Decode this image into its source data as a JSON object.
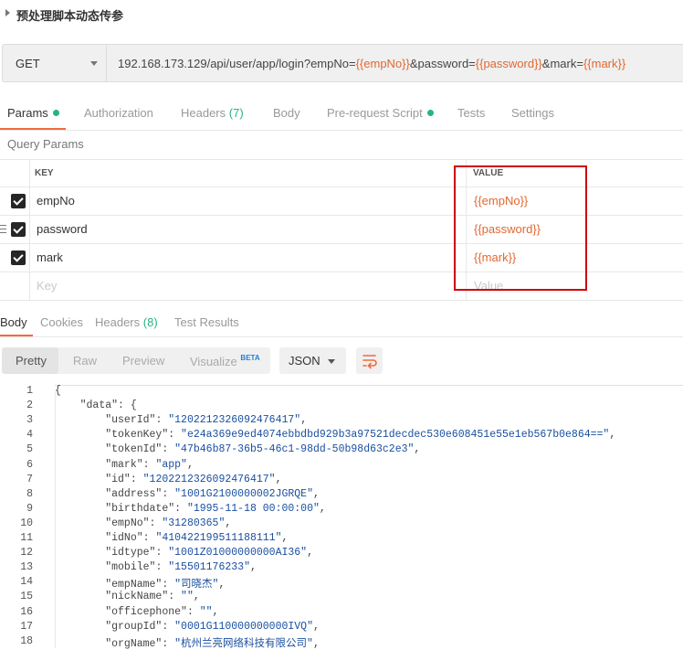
{
  "request": {
    "title": "预处理脚本动态传参",
    "method": "GET",
    "url_parts": [
      "192.168.173.129/api/user/app/login?empNo=",
      "{{empNo}}",
      "&password=",
      "{{password}}",
      "&mark=",
      "{{mark}}"
    ]
  },
  "tabs": {
    "params": "Params",
    "authorization": "Authorization",
    "headers": "Headers",
    "headers_count": "(7)",
    "body": "Body",
    "prerequest": "Pre-request Script",
    "tests": "Tests",
    "settings": "Settings"
  },
  "query": {
    "section_label": "Query Params",
    "col_key": "KEY",
    "col_value": "VALUE",
    "rows": [
      {
        "key": "empNo",
        "value": "{{empNo}}"
      },
      {
        "key": "password",
        "value": "{{password}}"
      },
      {
        "key": "mark",
        "value": "{{mark}}"
      }
    ],
    "key_placeholder": "Key",
    "value_placeholder": "Value"
  },
  "response": {
    "tabs": {
      "body": "Body",
      "cookies": "Cookies",
      "headers": "Headers",
      "headers_count": "(8)",
      "test_results": "Test Results"
    },
    "view": {
      "pretty": "Pretty",
      "raw": "Raw",
      "preview": "Preview",
      "visualize": "Visualize",
      "beta": "BETA",
      "format": "JSON"
    },
    "line_numbers": [
      "1",
      "2",
      "3",
      "4",
      "5",
      "6",
      "7",
      "8",
      "9",
      "10",
      "11",
      "12",
      "13",
      "14",
      "15",
      "16",
      "17",
      "18"
    ],
    "code": [
      {
        "indent": "",
        "key": "",
        "value": "",
        "text": "{"
      },
      {
        "indent": "    ",
        "key": "\"data\"",
        "sep": ": ",
        "value": "",
        "text": "{"
      },
      {
        "indent": "        ",
        "key": "\"userId\"",
        "sep": ": ",
        "value": "\"1202212326092476417\"",
        "text": ","
      },
      {
        "indent": "        ",
        "key": "\"tokenKey\"",
        "sep": ": ",
        "value": "\"e24a369e9ed4074ebbdbd929b3a97521decdec530e608451e55e1eb567b0e864==\"",
        "text": ","
      },
      {
        "indent": "        ",
        "key": "\"tokenId\"",
        "sep": ": ",
        "value": "\"47b46b87-36b5-46c1-98dd-50b98d63c2e3\"",
        "text": ","
      },
      {
        "indent": "        ",
        "key": "\"mark\"",
        "sep": ": ",
        "value": "\"app\"",
        "text": ","
      },
      {
        "indent": "        ",
        "key": "\"id\"",
        "sep": ": ",
        "value": "\"1202212326092476417\"",
        "text": ","
      },
      {
        "indent": "        ",
        "key": "\"address\"",
        "sep": ": ",
        "value": "\"1001G2100000002JGRQE\"",
        "text": ","
      },
      {
        "indent": "        ",
        "key": "\"birthdate\"",
        "sep": ": ",
        "value": "\"1995-11-18 00:00:00\"",
        "text": ","
      },
      {
        "indent": "        ",
        "key": "\"empNo\"",
        "sep": ": ",
        "value": "\"31280365\"",
        "text": ","
      },
      {
        "indent": "        ",
        "key": "\"idNo\"",
        "sep": ": ",
        "value": "\"410422199511188111\"",
        "text": ","
      },
      {
        "indent": "        ",
        "key": "\"idtype\"",
        "sep": ": ",
        "value": "\"1001Z01000000000AI36\"",
        "text": ","
      },
      {
        "indent": "        ",
        "key": "\"mobile\"",
        "sep": ": ",
        "value": "\"15501176233\"",
        "text": ","
      },
      {
        "indent": "        ",
        "key": "\"empName\"",
        "sep": ": ",
        "value": "\"司晓杰\"",
        "text": ","
      },
      {
        "indent": "        ",
        "key": "\"nickName\"",
        "sep": ": ",
        "value": "\"\"",
        "text": ","
      },
      {
        "indent": "        ",
        "key": "\"officephone\"",
        "sep": ": ",
        "value": "\"\"",
        "text": ","
      },
      {
        "indent": "        ",
        "key": "\"groupId\"",
        "sep": ": ",
        "value": "\"0001G110000000000IVQ\"",
        "text": ","
      },
      {
        "indent": "        ",
        "key": "\"orgName\"",
        "sep": ": ",
        "value": "\"杭州兰亮网络科技有限公司\"",
        "text": ","
      }
    ]
  },
  "colors": {
    "accent": "#f26b3a",
    "variable": "#e2682f",
    "status_green": "#26b47f",
    "highlight_box": "#d00000",
    "json_string": "#1a4fa0"
  },
  "icons": {
    "title_toggle": "triangle-right-icon",
    "method_dropdown": "chevron-down-icon",
    "checkbox": "checkbox-checked-icon",
    "drag_handle": "drag-handle-icon",
    "wrap_lines": "wrap-lines-icon"
  }
}
